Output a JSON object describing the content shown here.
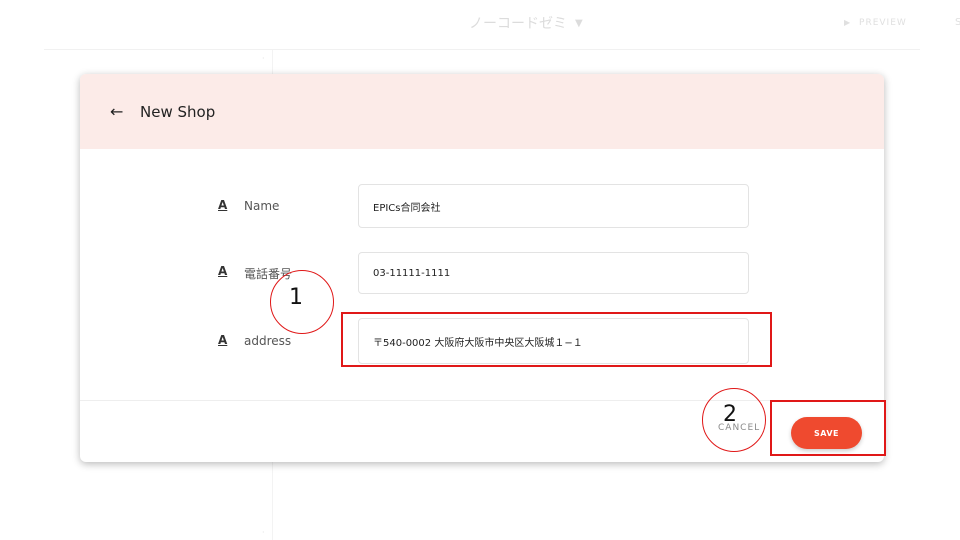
{
  "app": {
    "title": "ノーコードゼミ",
    "preview_label": "PREVIEW",
    "extra_label": "S"
  },
  "dialog": {
    "title": "New Shop"
  },
  "fields": [
    {
      "label": "Name",
      "value": "EPICs合同会社"
    },
    {
      "label": "電話番号",
      "value": "03-11111-1111"
    },
    {
      "label": "address",
      "value": "〒540-0002 大阪府大阪市中央区大阪城１−１"
    }
  ],
  "footer": {
    "cancel_label": "CANCEL",
    "save_label": "SAVE"
  },
  "annotations": [
    {
      "number": "1"
    },
    {
      "number": "2"
    }
  ],
  "colors": {
    "accent": "#ef4a2f",
    "header_bg": "#fcebe8",
    "annotation": "#e01818"
  }
}
